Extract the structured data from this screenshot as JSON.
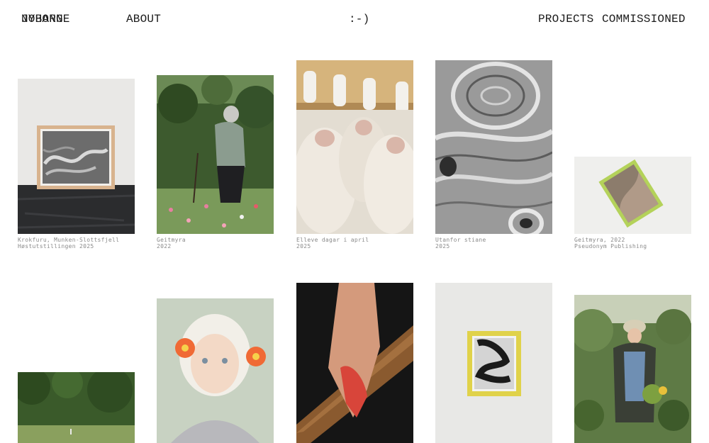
{
  "nav": {
    "title_line1": "JOHANNE",
    "title_line2": "NYBORG",
    "about": "ABOUT",
    "smile": ":-)",
    "projects": "PROJECTS",
    "commissioned": "COMMISSIONED"
  },
  "row1": [
    {
      "line1": "Krokfuru, Munken-Slottsfjell",
      "line2": "Høstutstillingen 2025"
    },
    {
      "line1": "Geitmyra",
      "line2": "2022"
    },
    {
      "line1": "Elleve dagar i april",
      "line2": "2025"
    },
    {
      "line1": "Utanfor stiane",
      "line2": "2025"
    },
    {
      "line1": "Geitmyra, 2022",
      "line2": "Pseudonym Publishing"
    }
  ]
}
